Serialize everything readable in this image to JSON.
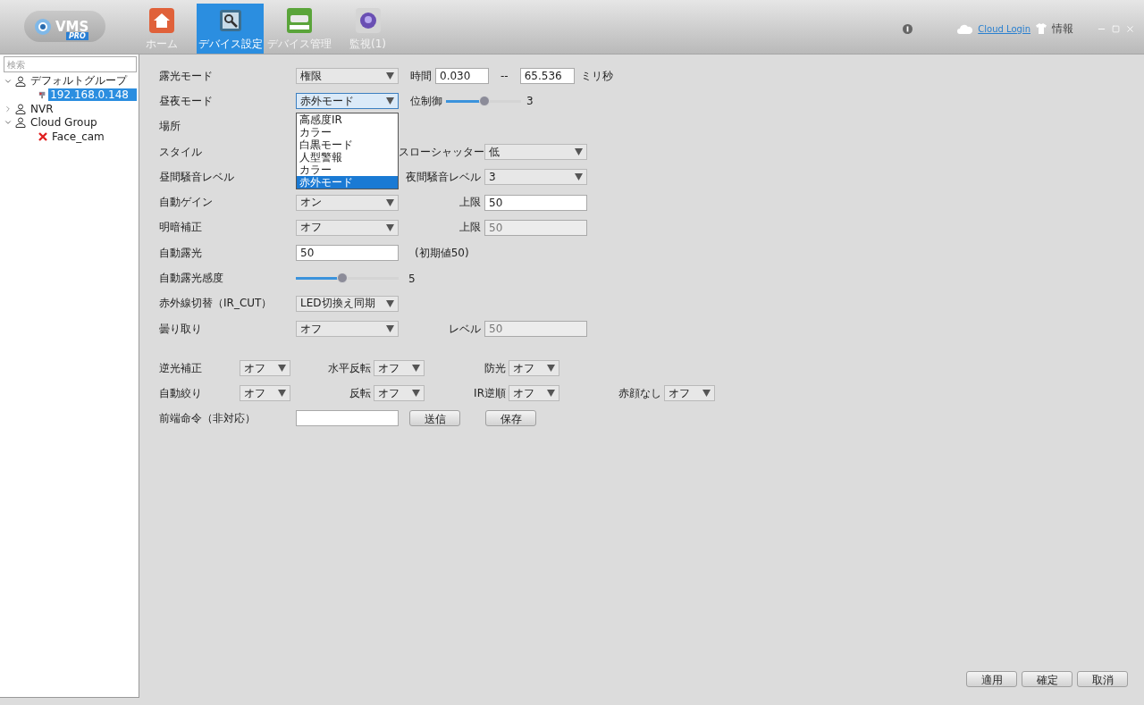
{
  "app": {
    "logo": "VMS",
    "logo_badge": "PRO"
  },
  "nav_tabs": [
    {
      "label": "ホーム",
      "kind": "home",
      "selected": false
    },
    {
      "label": "デバイス設定",
      "kind": "config",
      "selected": true
    },
    {
      "label": "デバイス管理",
      "kind": "device",
      "selected": false
    },
    {
      "label": "監視(1)",
      "kind": "monitor",
      "selected": false
    }
  ],
  "header": {
    "cloud_login": "Cloud Login",
    "info": "情報"
  },
  "sidebar": {
    "search": {
      "placeholder": "検索"
    },
    "tree": [
      {
        "label": "デフォルトグループ",
        "kind": "group",
        "expanded": true,
        "selected": false,
        "children": [
          {
            "label": "192.168.0.148",
            "kind": "camera",
            "selected": true
          }
        ]
      },
      {
        "label": "NVR",
        "kind": "group",
        "expanded": false,
        "selected": false
      },
      {
        "label": "Cloud Group",
        "kind": "group",
        "expanded": true,
        "selected": false,
        "children": [
          {
            "label": "Face_cam",
            "kind": "offline",
            "selected": false
          }
        ]
      }
    ]
  },
  "settings": [
    {
      "label": "露光モード",
      "control": {
        "kind": "select",
        "value": "権限"
      },
      "extra": {
        "kind": "range",
        "label": "時間",
        "from": "0.030",
        "separator": "--",
        "to": "65.536",
        "unit": "ミリ秒"
      }
    },
    {
      "label": "昼夜モード",
      "control": {
        "kind": "select",
        "value": "赤外モード",
        "open": true,
        "options": [
          {
            "label": "高感度IR",
            "selected": false
          },
          {
            "label": "カラー",
            "selected": false
          },
          {
            "label": "白黒モード",
            "selected": false
          },
          {
            "label": "人型警報",
            "selected": false
          },
          {
            "label": "カラー",
            "selected": false
          },
          {
            "label": "赤外モード",
            "selected": true
          }
        ]
      },
      "extra": {
        "kind": "slider",
        "label": "位制御",
        "level": 0.51,
        "reading": "3"
      }
    },
    {
      "label": "場所"
    },
    {
      "label": "スタイル",
      "extra": {
        "kind": "select",
        "label": "スローシャッター",
        "value": "低"
      }
    },
    {
      "label": "昼間騒音レベル",
      "extra": {
        "kind": "select",
        "label": "夜間騒音レベル",
        "value": "3"
      }
    },
    {
      "label": "自動ゲイン",
      "control": {
        "kind": "select",
        "value": "オン"
      },
      "extra": {
        "kind": "input",
        "label": "上限",
        "value": "50",
        "disabled": false
      }
    },
    {
      "label": "明暗補正",
      "control": {
        "kind": "select",
        "value": "オフ"
      },
      "extra": {
        "kind": "input",
        "label": "上限",
        "value": "50",
        "disabled": true
      }
    },
    {
      "label": "自動露光",
      "control": {
        "kind": "input",
        "value": "50"
      },
      "extra": {
        "kind": "note",
        "text": "(初期値50)"
      }
    },
    {
      "label": "自動露光感度",
      "control": {
        "kind": "slider",
        "level": 0.45,
        "reading": "5"
      }
    },
    {
      "label": "赤外線切替（IR_CUT）",
      "control": {
        "kind": "select",
        "value": "LED切換え同期"
      }
    },
    {
      "label": "曇り取り",
      "control": {
        "kind": "select",
        "value": "オフ"
      },
      "extra": {
        "kind": "input",
        "label": "レベル",
        "value": "50",
        "disabled": true
      }
    }
  ],
  "toggles": [
    [
      {
        "label": "逆光補正",
        "value": "オフ"
      },
      {
        "label": "水平反転",
        "value": "オフ"
      },
      {
        "label": "防光",
        "value": "オフ"
      }
    ],
    [
      {
        "label": "自動絞り",
        "value": "オフ"
      },
      {
        "label": "反転",
        "value": "オフ"
      },
      {
        "label": "IR逆順",
        "value": "オフ"
      },
      {
        "label": "赤顔なし",
        "value": "オフ"
      }
    ]
  ],
  "command": {
    "label": "前端命令（非対応）",
    "buttons": [
      "送信",
      "保存"
    ]
  },
  "footer_buttons": [
    "適用",
    "確定",
    "取消"
  ]
}
